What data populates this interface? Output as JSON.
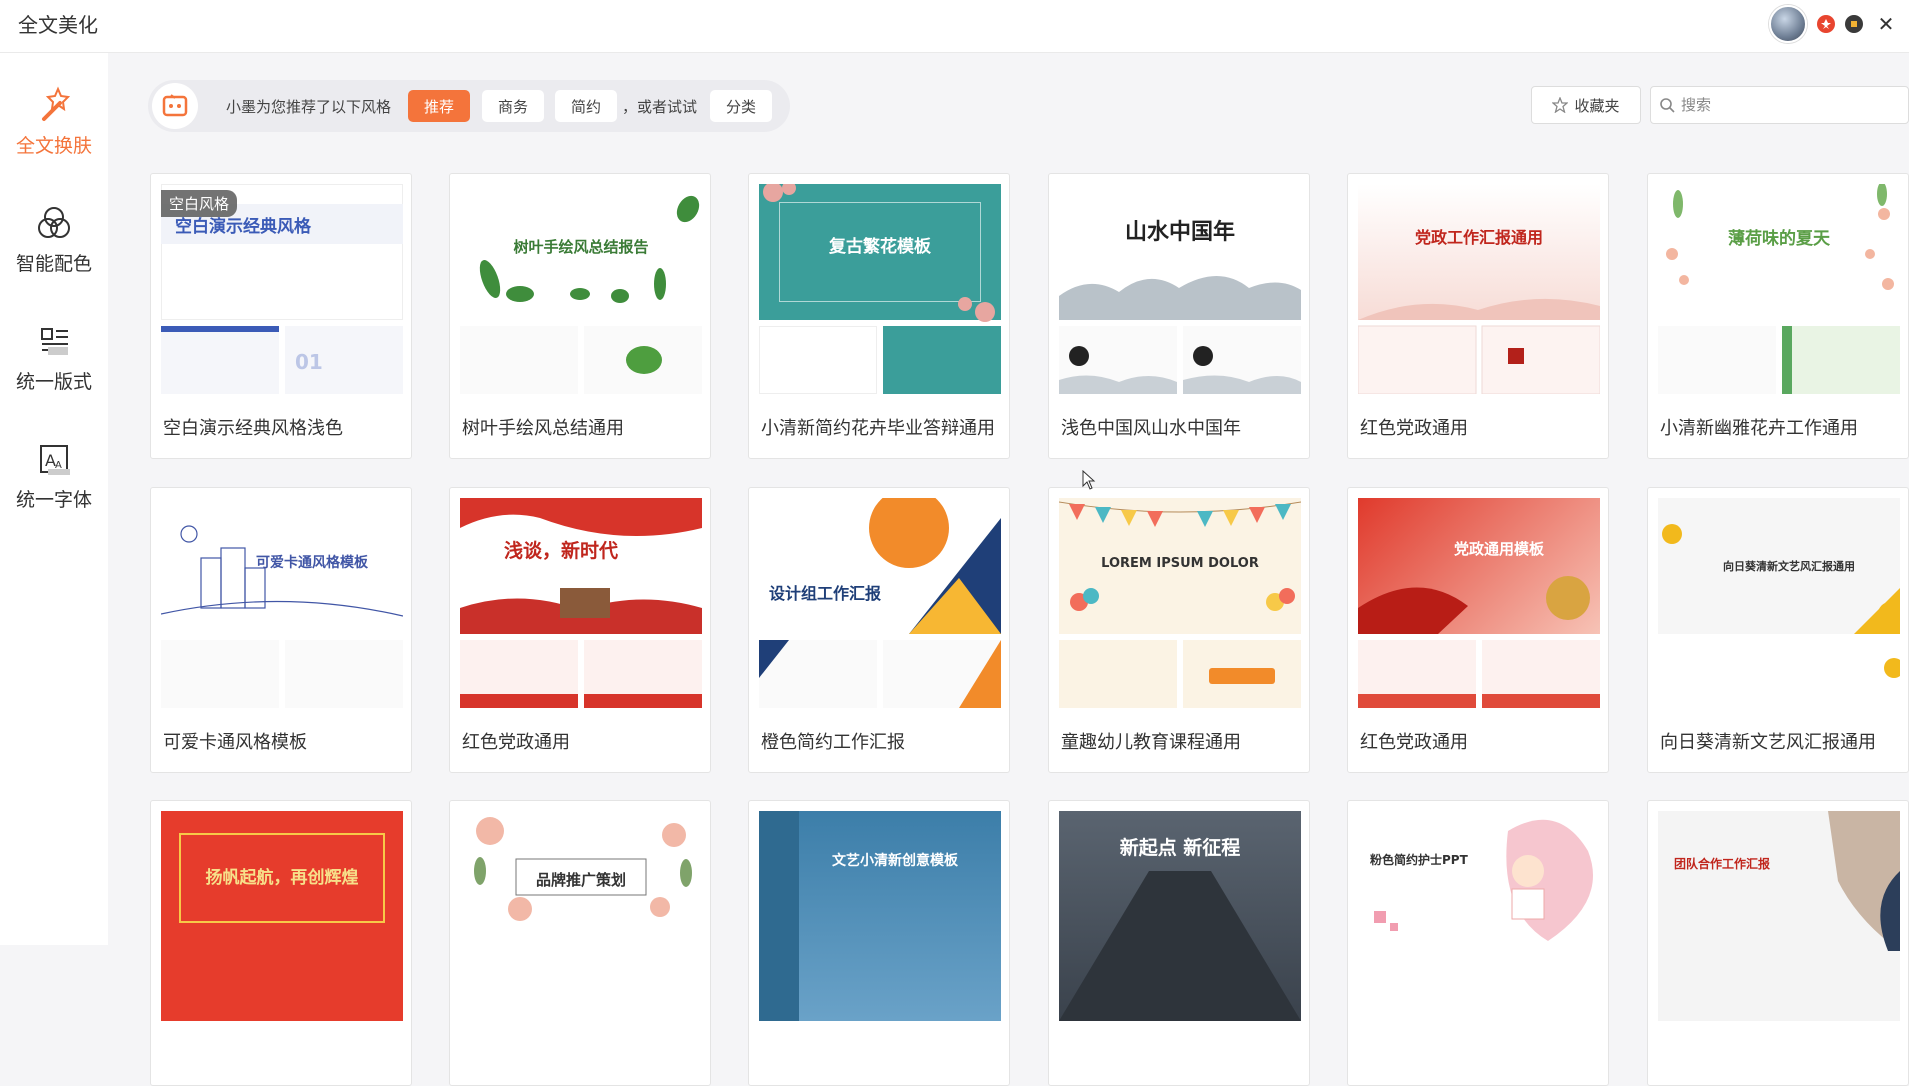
{
  "app": {
    "title": "全文美化"
  },
  "sidebar": {
    "items": [
      {
        "label": "全文换肤",
        "icon": "magic-wand-icon",
        "active": true
      },
      {
        "label": "智能配色",
        "icon": "color-circles-icon",
        "active": false
      },
      {
        "label": "统一版式",
        "icon": "layout-icon",
        "active": false
      },
      {
        "label": "统一字体",
        "icon": "font-icon",
        "active": false
      }
    ]
  },
  "recommend": {
    "text": "小墨为您推荐了以下风格",
    "chips": [
      "推荐",
      "商务",
      "简约"
    ],
    "or_text": "，或者试试",
    "category_chip": "分类"
  },
  "toolbar": {
    "favorites_label": "收藏夹",
    "search_placeholder": "搜索"
  },
  "colors": {
    "accent": "#f4743b"
  },
  "templates": [
    {
      "label": "空白演示经典风格浅色",
      "tag": "空白风格",
      "title": "空白演示经典风格"
    },
    {
      "label": "树叶手绘风总结通用",
      "title": "树叶手绘风总结报告"
    },
    {
      "label": "小清新简约花卉毕业答辩通用",
      "title": "复古繁花模板"
    },
    {
      "label": "浅色中国风山水中国年",
      "title": "山水中国年"
    },
    {
      "label": "红色党政通用",
      "title": "党政工作汇报通用"
    },
    {
      "label": "小清新幽雅花卉工作通用",
      "title": "薄荷味的夏天"
    },
    {
      "label": "可爱卡通风格模板",
      "title": "可爱卡通风格模板"
    },
    {
      "label": "红色党政通用",
      "title": "浅谈，新时代"
    },
    {
      "label": "橙色简约工作汇报",
      "title": "设计组工作汇报"
    },
    {
      "label": "童趣幼儿教育课程通用",
      "title": "LOREM IPSUM DOLOR"
    },
    {
      "label": "红色党政通用",
      "title": "党政通用模板"
    },
    {
      "label": "向日葵清新文艺风汇报通用",
      "title": "向日葵清新文艺风汇报通用"
    },
    {
      "label": "",
      "title": "扬帆起航，再创辉煌"
    },
    {
      "label": "",
      "title": "品牌推广策划"
    },
    {
      "label": "",
      "title": "文艺小清新创意模板"
    },
    {
      "label": "",
      "title": "新起点 新征程"
    },
    {
      "label": "",
      "title": "粉色简约护士PPT"
    },
    {
      "label": "",
      "title": "团队合作工作汇报"
    }
  ]
}
